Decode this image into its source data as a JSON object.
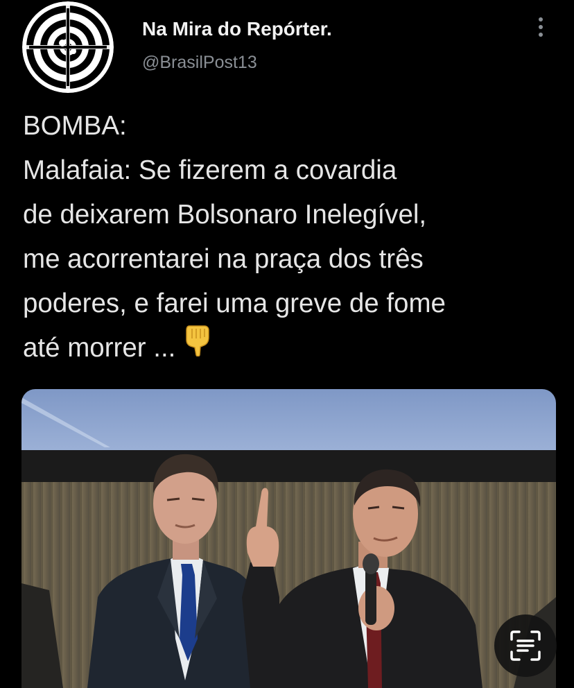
{
  "tweet": {
    "author": {
      "name": "Na Mira do Repórter.",
      "handle": "@BrasilPost13",
      "avatar_icon": "target-icon"
    },
    "more_icon": "vertical-dots-icon",
    "text_lines": [
      "BOMBA:",
      "Malafaia: Se fizerem a covardia",
      "de deixarem Bolsonaro Inelegível,",
      "me acorrentarei na praça dos três",
      "poderes, e farei uma greve de fome",
      "até morrer ..."
    ],
    "emoji": "pointing-down-icon",
    "media": {
      "description_icon": "photo"
    }
  },
  "overlay": {
    "scan_icon": "text-scan-icon"
  },
  "colors": {
    "background": "#000000",
    "text": "#e6e6e6",
    "handle": "#8a8f95"
  }
}
